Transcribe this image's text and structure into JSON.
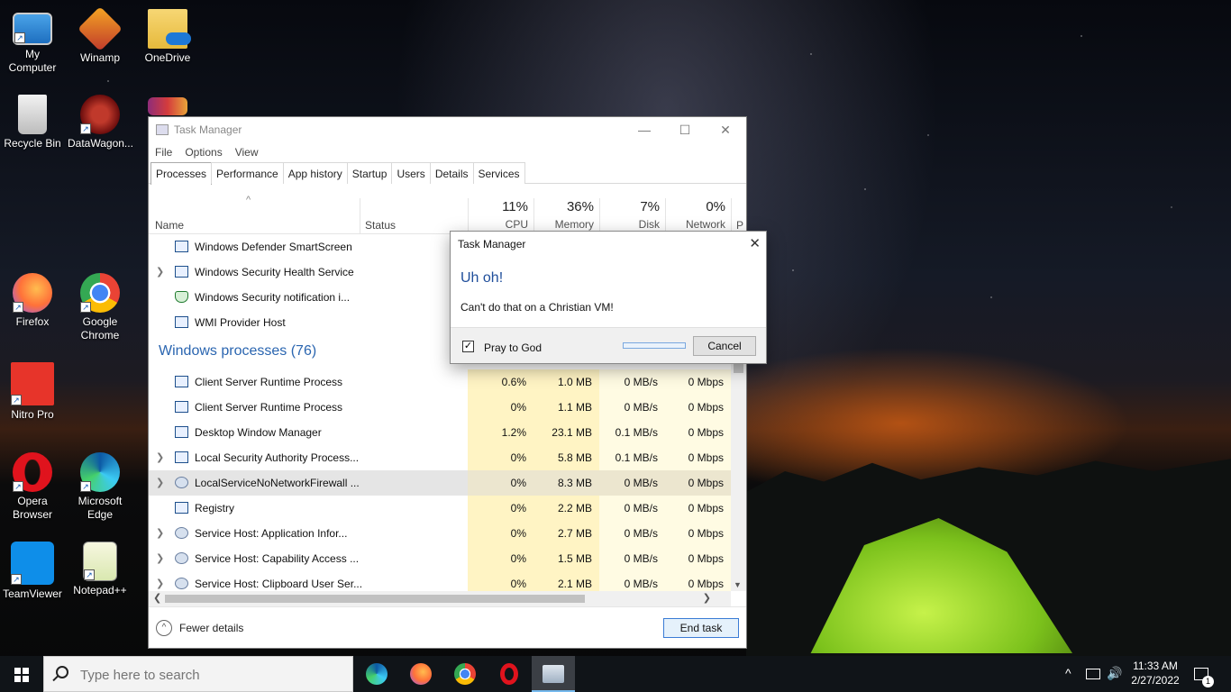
{
  "desktop": {
    "icons": [
      {
        "label": "My Computer"
      },
      {
        "label": "Winamp"
      },
      {
        "label": "OneDrive"
      },
      {
        "label": "Recycle Bin"
      },
      {
        "label": "DataWagon..."
      },
      {
        "label": "Firefox"
      },
      {
        "label": "Google Chrome"
      },
      {
        "label": "Nitro Pro"
      },
      {
        "label": "Opera Browser"
      },
      {
        "label": "Microsoft Edge"
      },
      {
        "label": "TeamViewer"
      },
      {
        "label": "Notepad++"
      }
    ]
  },
  "task_manager": {
    "title": "Task Manager",
    "menu": [
      "File",
      "Options",
      "View"
    ],
    "tabs": [
      "Processes",
      "Performance",
      "App history",
      "Startup",
      "Users",
      "Details",
      "Services"
    ],
    "columns": {
      "name": "Name",
      "status": "Status",
      "cpu": {
        "pct": "11%",
        "label": "CPU"
      },
      "memory": {
        "pct": "36%",
        "label": "Memory"
      },
      "disk": {
        "pct": "7%",
        "label": "Disk"
      },
      "network": {
        "pct": "0%",
        "label": "Network"
      },
      "more": "P"
    },
    "app_rows": [
      {
        "name": "Windows Defender SmartScreen"
      },
      {
        "name": "Windows Security Health Service"
      },
      {
        "name": "Windows Security notification i..."
      },
      {
        "name": "WMI Provider Host"
      }
    ],
    "group_label": "Windows processes (76)",
    "win_rows": [
      {
        "name": "Client Server Runtime Process",
        "cpu": "0.6%",
        "mem": "1.0 MB",
        "disk": "0 MB/s",
        "net": "0 Mbps"
      },
      {
        "name": "Client Server Runtime Process",
        "cpu": "0%",
        "mem": "1.1 MB",
        "disk": "0 MB/s",
        "net": "0 Mbps"
      },
      {
        "name": "Desktop Window Manager",
        "cpu": "1.2%",
        "mem": "23.1 MB",
        "disk": "0.1 MB/s",
        "net": "0 Mbps"
      },
      {
        "name": "Local Security Authority Process...",
        "cpu": "0%",
        "mem": "5.8 MB",
        "disk": "0.1 MB/s",
        "net": "0 Mbps"
      },
      {
        "name": "LocalServiceNoNetworkFirewall ...",
        "cpu": "0%",
        "mem": "8.3 MB",
        "disk": "0 MB/s",
        "net": "0 Mbps"
      },
      {
        "name": "Registry",
        "cpu": "0%",
        "mem": "2.2 MB",
        "disk": "0 MB/s",
        "net": "0 Mbps"
      },
      {
        "name": "Service Host: Application Infor...",
        "cpu": "0%",
        "mem": "2.7 MB",
        "disk": "0 MB/s",
        "net": "0 Mbps"
      },
      {
        "name": "Service Host: Capability Access ...",
        "cpu": "0%",
        "mem": "1.5 MB",
        "disk": "0 MB/s",
        "net": "0 Mbps"
      },
      {
        "name": "Service Host: Clipboard User Ser...",
        "cpu": "0%",
        "mem": "2.1 MB",
        "disk": "0 MB/s",
        "net": "0 Mbps"
      }
    ],
    "fewer_details": "Fewer details",
    "end_task": "End task"
  },
  "dialog": {
    "title": "Task Manager",
    "heading": "Uh oh!",
    "message": "Can't do that on a Christian VM!",
    "checkbox_label": "Pray to God",
    "checkbox_checked": true,
    "cancel": "Cancel"
  },
  "taskbar": {
    "search_placeholder": "Type here to search",
    "time": "11:33 AM",
    "date": "2/27/2022",
    "notification_count": "1"
  },
  "colors": {
    "accent": "#2a65b0",
    "cpu_column": "#fff4c4",
    "taskbar": "#101418"
  }
}
